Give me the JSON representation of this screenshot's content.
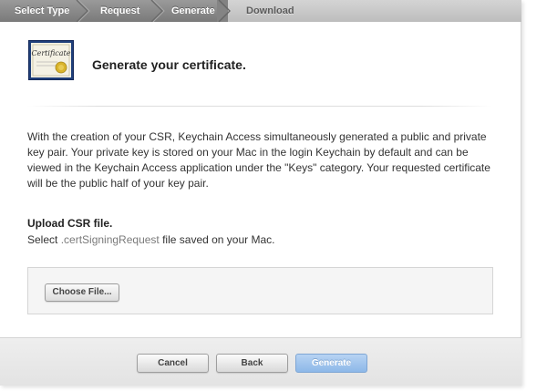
{
  "breadcrumbs": {
    "steps": [
      "Select Type",
      "Request",
      "Generate",
      "Download"
    ],
    "current": "Generate"
  },
  "header": {
    "icon": "certificate-icon",
    "icon_text": "Certificate",
    "title": "Generate your certificate."
  },
  "body": {
    "paragraph": "With the creation of your CSR, Keychain Access simultaneously generated a public and private key pair. Your private key is stored on your Mac in the login Keychain by default and can be viewed in the Keychain Access application under the \"Keys\" category. Your requested certificate will be the public half of your key pair."
  },
  "upload": {
    "title": "Upload CSR file.",
    "desc_prefix": "Select ",
    "desc_ext": ".certSigningRequest",
    "desc_suffix": " file saved on your Mac.",
    "choose_label": "Choose File..."
  },
  "footer": {
    "cancel_label": "Cancel",
    "back_label": "Back",
    "generate_label": "Generate"
  },
  "colors": {
    "crumb_active": "#8a8a8a",
    "crumb_pending": "#c8c8c8",
    "primary_button": "#9dc3ee",
    "cert_border": "#1f3f7a"
  }
}
